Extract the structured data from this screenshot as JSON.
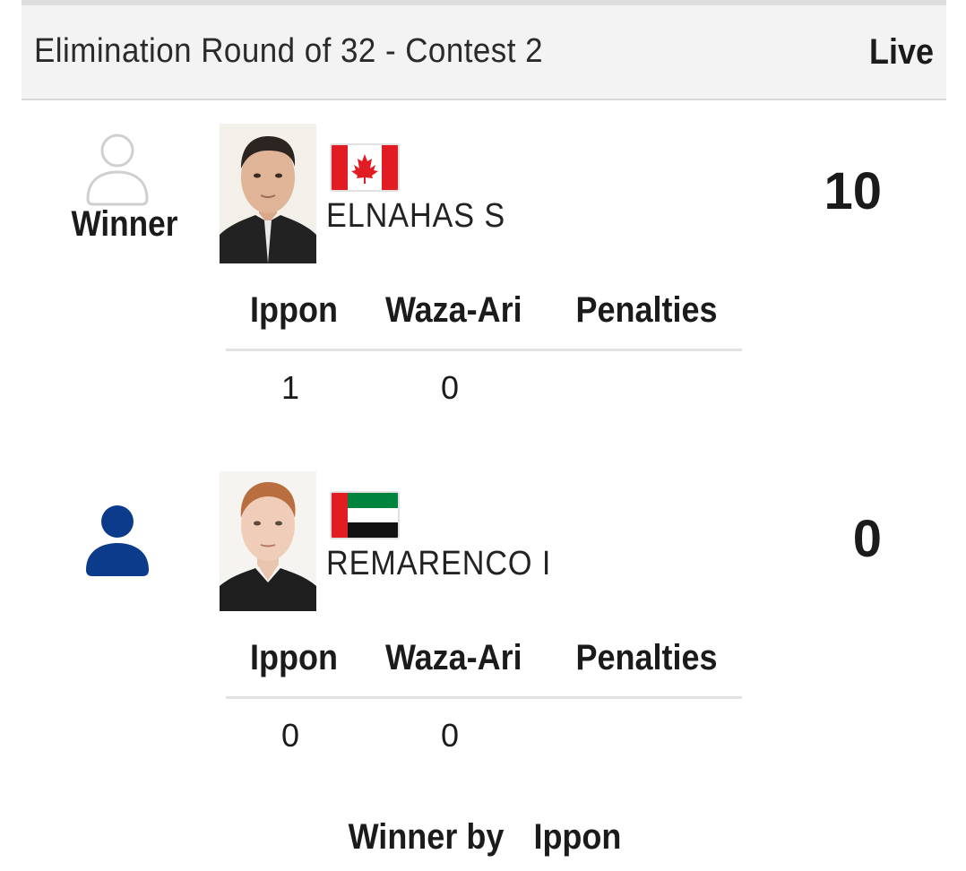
{
  "header": {
    "title": "Elimination Round of 32 - Contest 2",
    "status": "Live"
  },
  "stat_columns": {
    "ippon": "Ippon",
    "waza_ari": "Waza-Ari",
    "penalties": "Penalties"
  },
  "competitors": [
    {
      "status_label": "Winner",
      "status_icon": "person-outline-icon",
      "name": "ELNAHAS S",
      "flag": "canada-flag",
      "score": "10",
      "ippon": "1",
      "waza_ari": "0",
      "penalties": ""
    },
    {
      "status_label": "",
      "status_icon": "person-filled-icon",
      "icon_color": "#0d3b8c",
      "name": "REMARENCO I",
      "flag": "uae-flag",
      "score": "0",
      "ippon": "0",
      "waza_ari": "0",
      "penalties": ""
    }
  ],
  "result": {
    "prefix": "Winner by",
    "method": "Ippon"
  }
}
